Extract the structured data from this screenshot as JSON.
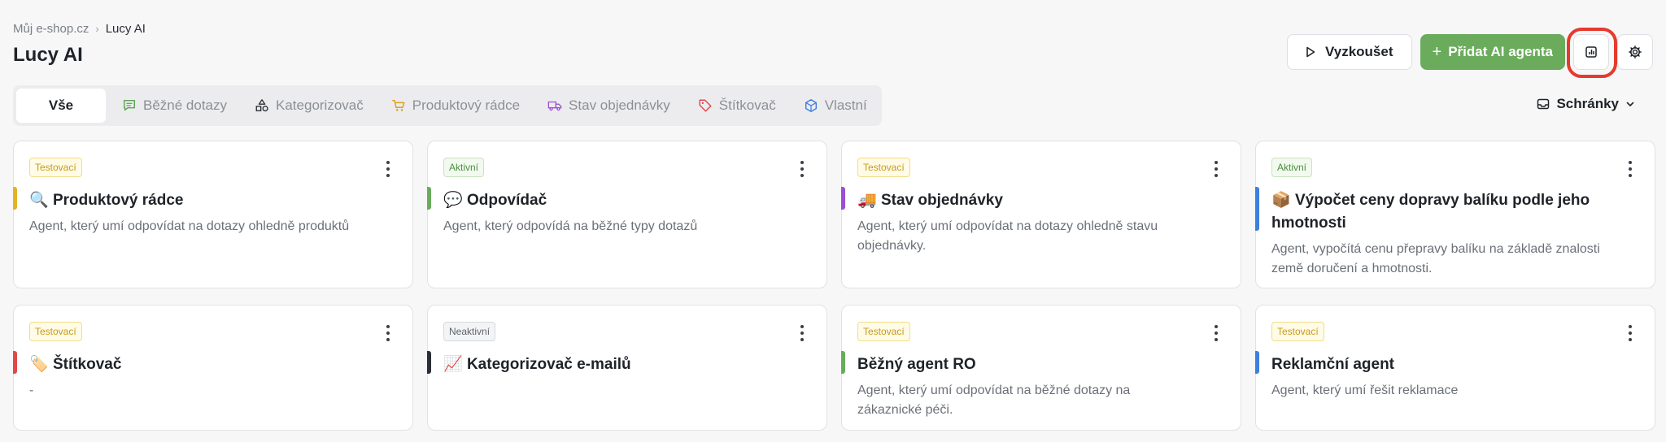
{
  "breadcrumb": {
    "root": "Můj e-shop.cz",
    "current": "Lucy AI"
  },
  "page": {
    "title": "Lucy AI"
  },
  "actions": {
    "try_label": "Vyzkoušet",
    "add_label": "Přidat AI agenta"
  },
  "tabs": [
    {
      "label": "Vše"
    },
    {
      "label": "Běžné dotazy",
      "color": "#5aa64f",
      "icon": "chat-icon"
    },
    {
      "label": "Kategorizovač",
      "color": "#2b2f35",
      "icon": "shapes-icon"
    },
    {
      "label": "Produktový rádce",
      "color": "#d9a21b",
      "icon": "cart-icon"
    },
    {
      "label": "Stav objednávky",
      "color": "#9b4fd6",
      "icon": "truck-icon"
    },
    {
      "label": "Štítkovač",
      "color": "#e2484a",
      "icon": "tag-icon"
    },
    {
      "label": "Vlastní",
      "color": "#3d7fe0",
      "icon": "box-icon"
    }
  ],
  "mailbox": {
    "label": "Schránky"
  },
  "cards": [
    {
      "status": "Testovací",
      "emoji": "🔍",
      "title": "Produktový rádce",
      "desc": "Agent, který umí odpovídat na dotazy ohledně produktů",
      "accent": "#e2b422"
    },
    {
      "status": "Aktivní",
      "emoji": "💬",
      "title": "Odpovídač",
      "desc": "Agent, který odpovídá na běžné typy dotazů",
      "accent": "#6aab5c"
    },
    {
      "status": "Testovací",
      "emoji": "🚚",
      "title": "Stav objednávky",
      "desc": "Agent, který umí odpovídat na dotazy ohledně stavu objednávky.",
      "accent": "#9b4fd6"
    },
    {
      "status": "Aktivní",
      "emoji": "📦",
      "title": "Výpočet ceny dopravy balíku podle jeho hmotnosti",
      "desc": "Agent, vypočítá cenu přepravy balíku na základě znalosti země doručení a hmotnosti.",
      "accent": "#3d7fe0"
    },
    {
      "status": "Testovací",
      "emoji": "🏷️",
      "title": "Štítkovač",
      "desc": "-",
      "accent": "#e2484a"
    },
    {
      "status": "Neaktivní",
      "emoji": "📈",
      "title": "Kategorizovač e-mailů",
      "desc": "",
      "accent": "#2b2f35"
    },
    {
      "status": "Testovací",
      "emoji": "",
      "title": "Běžný agent RO",
      "desc": "Agent, který umí odpovídat na běžné dotazy na zákaznické péči.",
      "accent": "#6aab5c"
    },
    {
      "status": "Testovací",
      "emoji": "",
      "title": "Reklamční agent",
      "desc": "Agent, který umí řešit reklamace",
      "accent": "#3d7fe0"
    }
  ]
}
